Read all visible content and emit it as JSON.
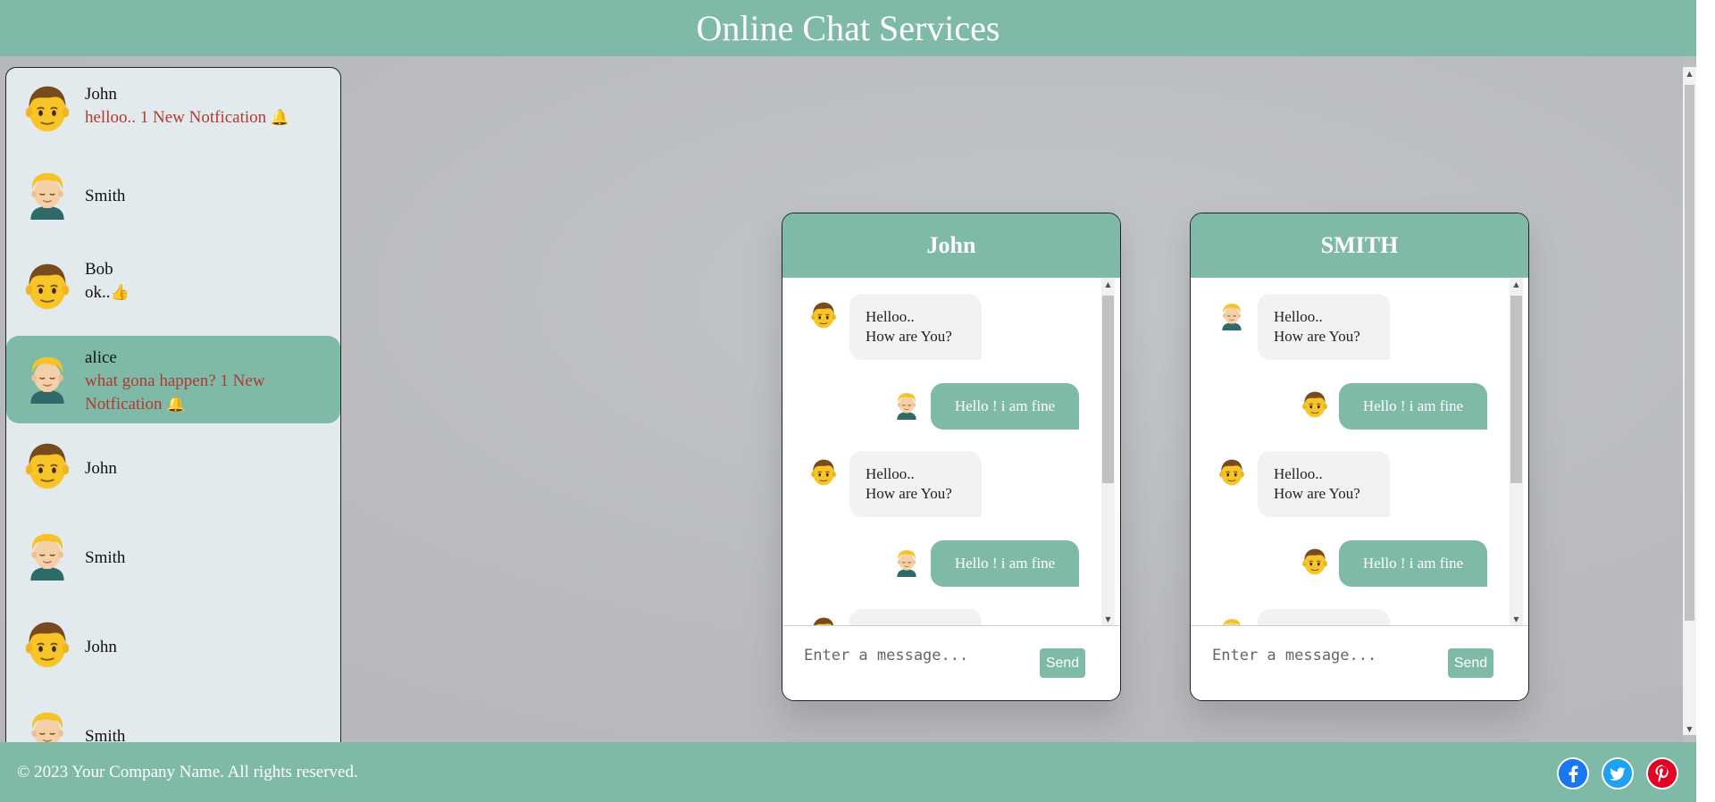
{
  "header": {
    "title": "Online Chat Services"
  },
  "contacts": [
    {
      "name": "John",
      "message": "helloo.. 1 New Notfication",
      "notification": true,
      "avatar": "boy-face-icon",
      "active": false
    },
    {
      "name": "Smith",
      "message": "",
      "notification": false,
      "avatar": "blond-person-icon",
      "active": false
    },
    {
      "name": "Bob",
      "message": "ok..",
      "notification": false,
      "avatar": "boy-face-icon",
      "active": false
    },
    {
      "name": "alice",
      "message": "what gona happen? 1 New Notfication",
      "notification": true,
      "avatar": "blond-person-icon",
      "active": true
    },
    {
      "name": "John",
      "message": "",
      "notification": false,
      "avatar": "boy-face-icon",
      "active": false
    },
    {
      "name": "Smith",
      "message": "",
      "notification": false,
      "avatar": "blond-person-icon",
      "active": false
    },
    {
      "name": "John",
      "message": "",
      "notification": false,
      "avatar": "boy-face-icon",
      "active": false
    },
    {
      "name": "Smith",
      "message": "",
      "notification": false,
      "avatar": "blond-person-icon",
      "active": false
    }
  ],
  "chats": [
    {
      "title": "John",
      "messages": [
        {
          "dir": "in",
          "line1": "Helloo..",
          "line2": "How are You?"
        },
        {
          "dir": "out",
          "text": "Hello ! i am fine"
        },
        {
          "dir": "in",
          "line1": "Helloo..",
          "line2": "How are You?"
        },
        {
          "dir": "out",
          "text": "Hello ! i am fine"
        }
      ],
      "input_placeholder": "Enter a message...",
      "send_label": "Send"
    },
    {
      "title": "SMITH",
      "messages": [
        {
          "dir": "in",
          "line1": "Helloo..",
          "line2": "How are You?"
        },
        {
          "dir": "out",
          "text": "Hello ! i am fine"
        },
        {
          "dir": "in",
          "line1": "Helloo..",
          "line2": "How are You?"
        },
        {
          "dir": "out",
          "text": "Hello ! i am fine"
        }
      ],
      "input_placeholder": "Enter a message...",
      "send_label": "Send"
    }
  ],
  "footer": {
    "copyright": "© 2023 Your Company Name. All rights reserved.",
    "social": [
      "facebook-icon",
      "twitter-icon",
      "pinterest-icon"
    ]
  },
  "colors": {
    "accent": "#7fbaa8",
    "notification": "#b03a2e",
    "facebook": "#1877f2",
    "twitter": "#1da1f2",
    "pinterest": "#e60023"
  }
}
